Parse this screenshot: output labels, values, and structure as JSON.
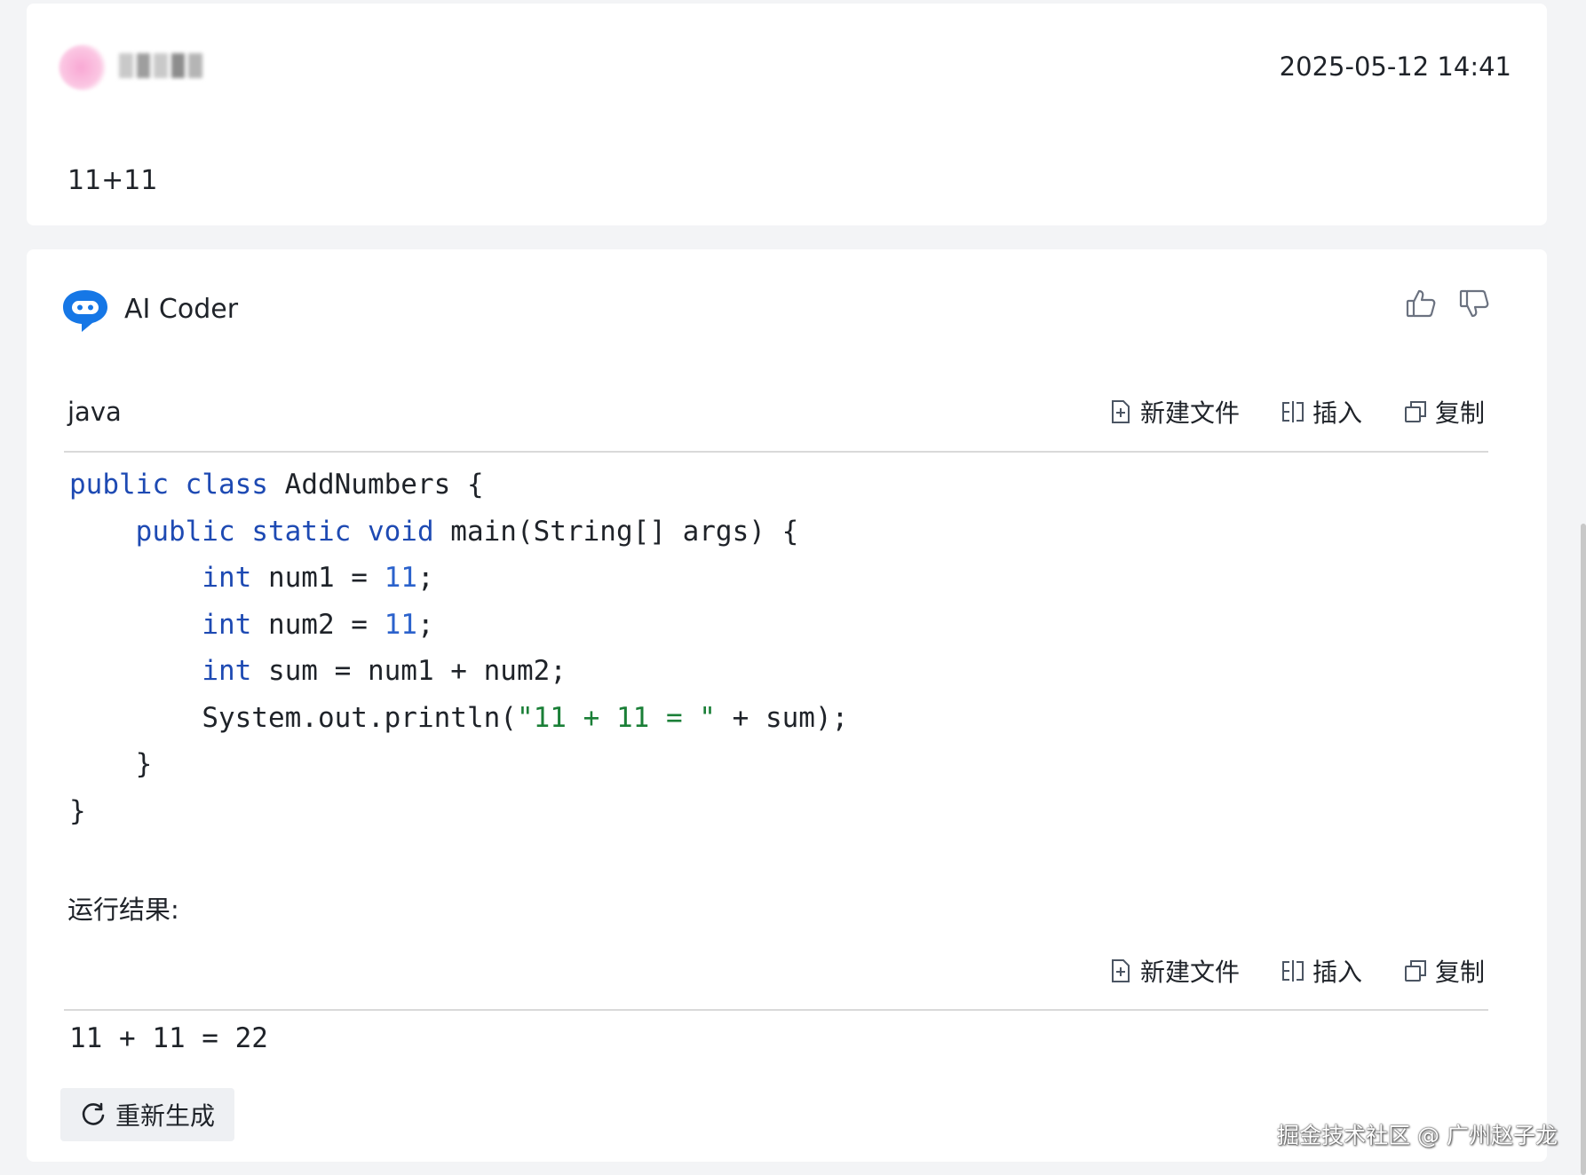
{
  "user_message": {
    "timestamp": "2025-05-12 14:41",
    "text": "11+11"
  },
  "ai_message": {
    "bot_name": "AI Coder",
    "code_language": "java",
    "code_lines": [
      "public class AddNumbers {",
      "    public static void main(String[] args) {",
      "        int num1 = 11;",
      "        int num2 = 11;",
      "        int sum = num1 + num2;",
      "        System.out.println(\"11 + 11 = \" + sum);",
      "    }",
      "}"
    ],
    "result_label": "运行结果:",
    "output_text": "11 + 11 = 22",
    "regenerate_label": "重新生成"
  },
  "toolbar": {
    "new_file_label": "新建文件",
    "insert_label": "插入",
    "copy_label": "复制"
  },
  "watermark": "掘金技术社区 @ 广州赵子龙",
  "icons": {
    "bot": "chat-bubble-bot-icon",
    "like": "thumbs-up-icon",
    "dislike": "thumbs-down-icon",
    "new_file": "file-plus-icon",
    "insert": "insert-icon",
    "copy": "copy-icon",
    "regenerate": "refresh-icon"
  },
  "colors": {
    "background": "#f3f4f6",
    "card": "#ffffff",
    "bot_icon": "#1677e6",
    "keyword": "#1e4ab3",
    "number": "#2b62cc",
    "string": "#1a7f37"
  }
}
